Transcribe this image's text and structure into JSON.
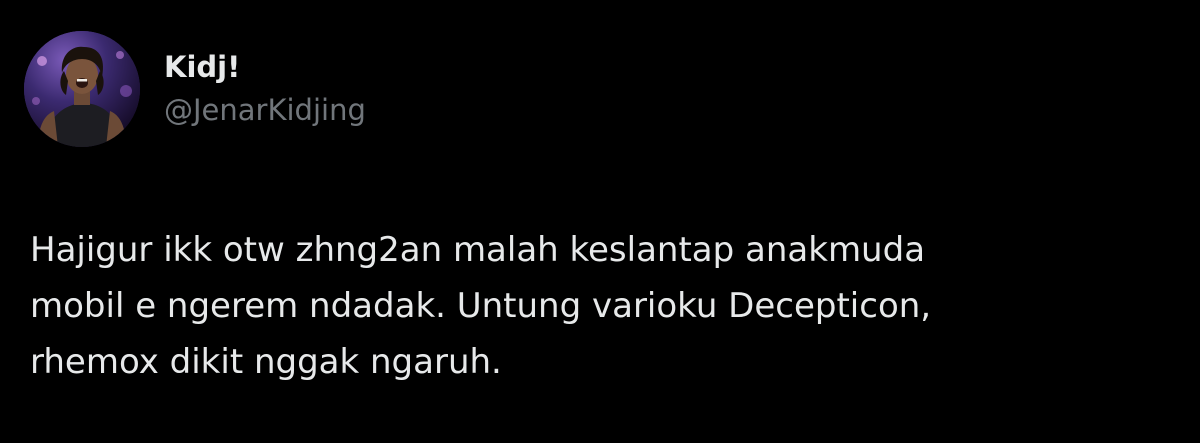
{
  "tweet": {
    "author": {
      "display_name": "Kidj!",
      "handle": "@JenarKidjing"
    },
    "text": "Hajigur ikk otw zhng2an malah keslantap anakmuda\nmobil e ngerem ndadak. Untung varioku Decepticon,\nrhemox dikit nggak ngaruh."
  },
  "colors": {
    "background": "#000000",
    "primary_text": "#e7e9ea",
    "secondary_text": "#71767b"
  }
}
